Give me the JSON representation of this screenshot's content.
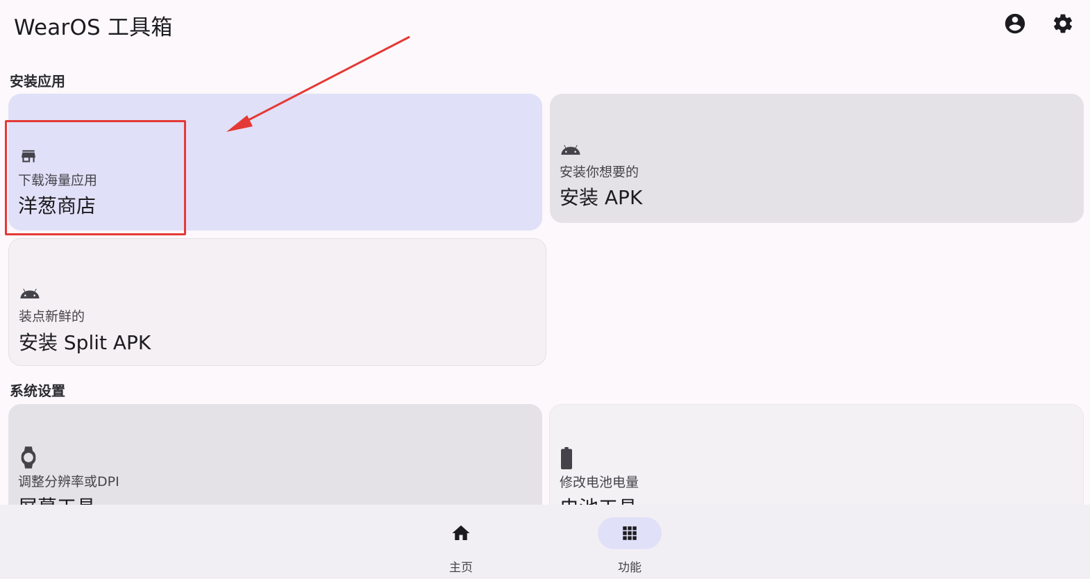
{
  "app": {
    "title": "WearOS 工具箱"
  },
  "header_actions": {
    "account_icon": "account-circle-icon",
    "settings_icon": "gear-icon"
  },
  "sections": {
    "install": {
      "title": "安装应用",
      "cards": [
        {
          "icon": "store-icon",
          "subtitle": "下载海量应用",
          "title": "洋葱商店"
        },
        {
          "icon": "android-icon",
          "subtitle": "安装你想要的",
          "title": "安装 APK"
        },
        {
          "icon": "android-icon",
          "subtitle": "装点新鲜的",
          "title": "安装 Split APK"
        }
      ]
    },
    "system": {
      "title": "系统设置",
      "cards": [
        {
          "icon": "watch-icon",
          "subtitle": "调整分辨率或DPI",
          "title": "屏幕工具"
        },
        {
          "icon": "battery-icon",
          "subtitle": "修改电池电量",
          "title": "电池工具"
        }
      ]
    }
  },
  "bottom_nav": {
    "items": [
      {
        "icon": "home-icon",
        "label": "主页",
        "selected": false
      },
      {
        "icon": "apps-grid-icon",
        "label": "功能",
        "selected": true
      }
    ]
  },
  "colors": {
    "background": "#fcf8fb",
    "selected_card": "#e0e0f8",
    "card_gray": "#e5e2e7",
    "annotation": "#e53935"
  }
}
